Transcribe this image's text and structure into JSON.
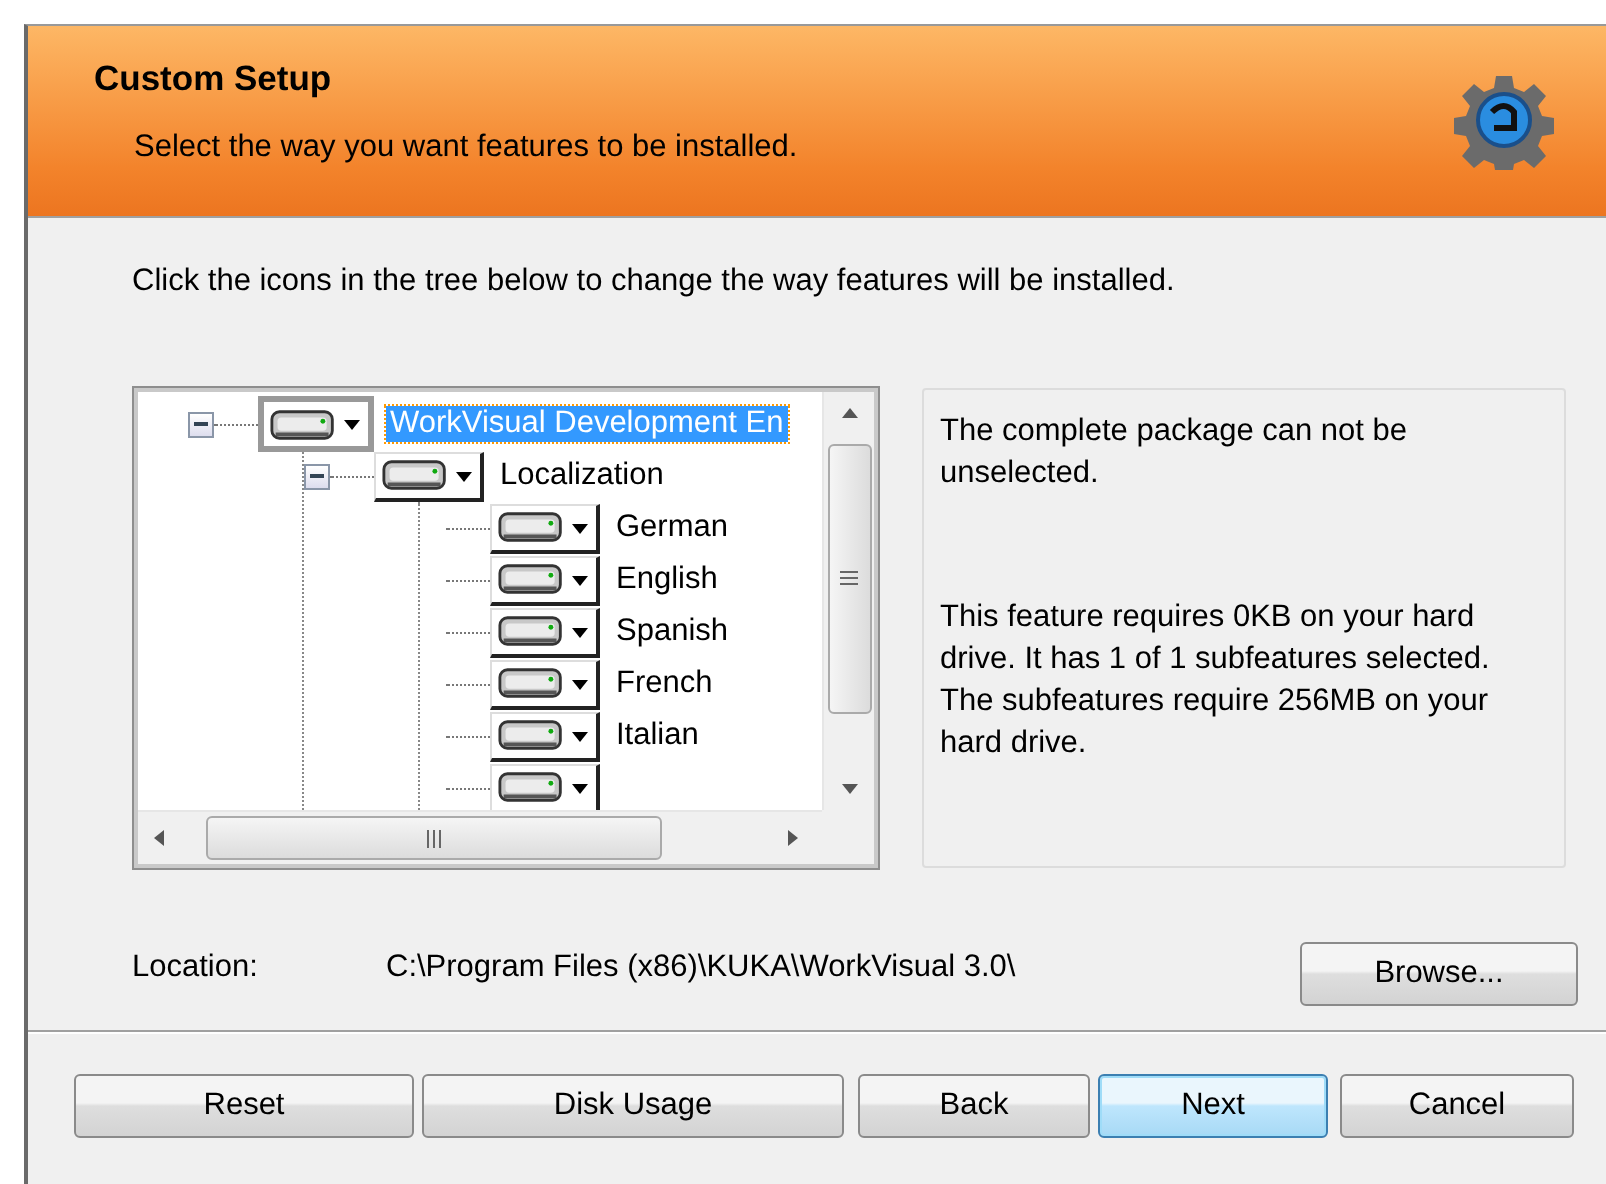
{
  "header": {
    "title": "Custom Setup",
    "subtitle": "Select the way you want features to be installed."
  },
  "instruction": "Click the icons in the tree below to change the way features will be installed.",
  "feature_tree": {
    "items": [
      {
        "label": "WorkVisual Development En",
        "selected": true,
        "expanded": true,
        "children": [
          {
            "label": "Localization",
            "selected": false,
            "expanded": true,
            "children": [
              {
                "label": "German",
                "selected": false
              },
              {
                "label": "English",
                "selected": false
              },
              {
                "label": "Spanish",
                "selected": false
              },
              {
                "label": "French",
                "selected": false
              },
              {
                "label": "Italian",
                "selected": false
              },
              {
                "selected": false
              }
            ]
          }
        ]
      }
    ]
  },
  "info_panel": {
    "description": "The complete package can not be unselected.",
    "requirements": "This feature requires 0KB on your hard drive. It has 1 of 1 subfeatures selected. The subfeatures require 256MB on your hard drive."
  },
  "location": {
    "label": "Location:",
    "path": "C:\\Program Files (x86)\\KUKA\\WorkVisual 3.0\\",
    "browse_button": "Browse..."
  },
  "buttons": [
    {
      "label": "Reset",
      "default": false
    },
    {
      "label": "Disk Usage",
      "default": false
    },
    {
      "label": "Back",
      "default": false
    },
    {
      "label": "Next",
      "default": true
    },
    {
      "label": "Cancel",
      "default": false
    }
  ]
}
